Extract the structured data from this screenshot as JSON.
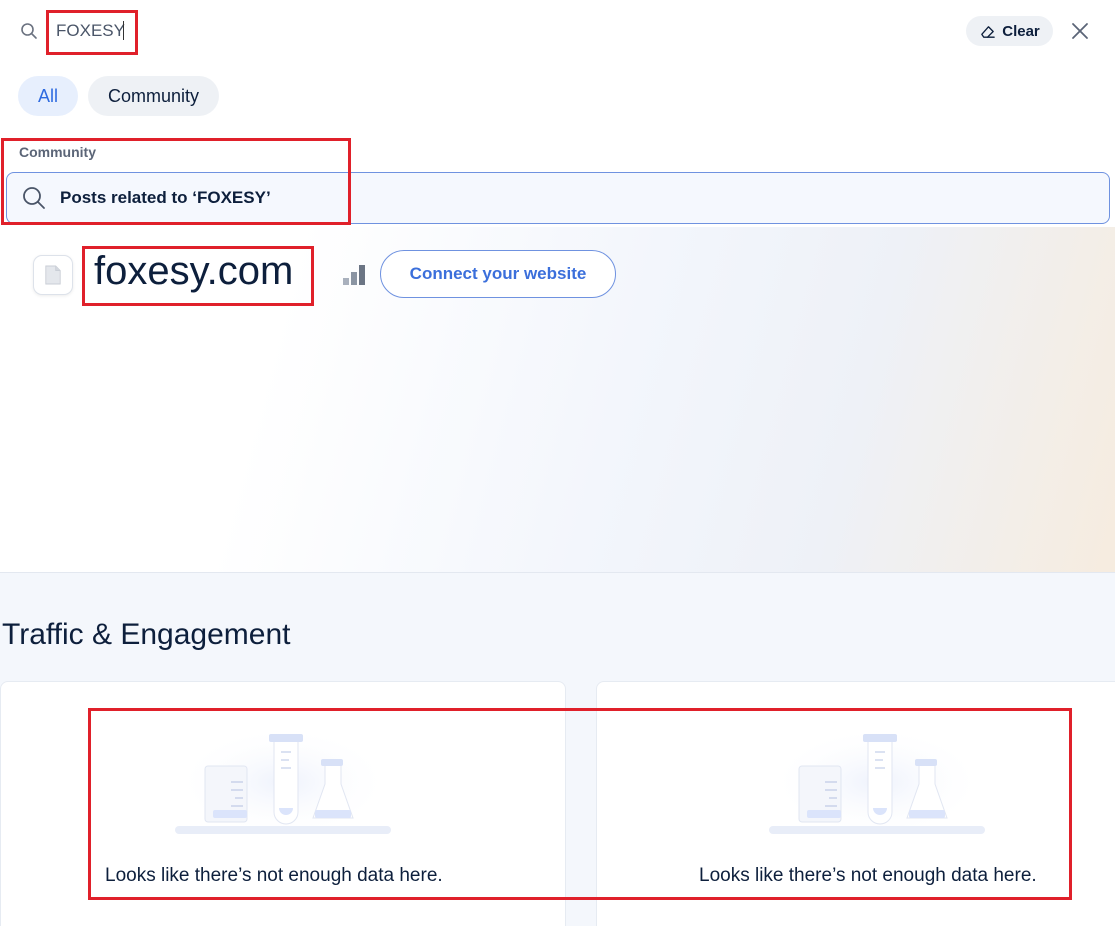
{
  "search": {
    "query": "FOXESY",
    "clear_label": "Clear"
  },
  "filters": [
    {
      "label": "All",
      "active": true
    },
    {
      "label": "Community",
      "active": false
    }
  ],
  "results": {
    "section_label": "Community",
    "suggestion": "Posts related to ‘FOXESY’"
  },
  "site": {
    "domain": "foxesy.com",
    "connect_label": "Connect your website"
  },
  "traffic": {
    "title": "Traffic & Engagement",
    "cards": [
      {
        "message": "Looks like there’s not enough data here."
      },
      {
        "message": "Looks like there’s not enough data here."
      }
    ]
  },
  "icons": {
    "search": "search-icon",
    "clear": "eraser-icon",
    "close": "close-icon",
    "favicon": "document-icon",
    "rank": "rank-bars-icon",
    "illustration": "lab-flasks-illustration"
  },
  "colors": {
    "accent": "#2f6be0",
    "annotation": "#e0202a",
    "text": "#0d1f3c"
  }
}
